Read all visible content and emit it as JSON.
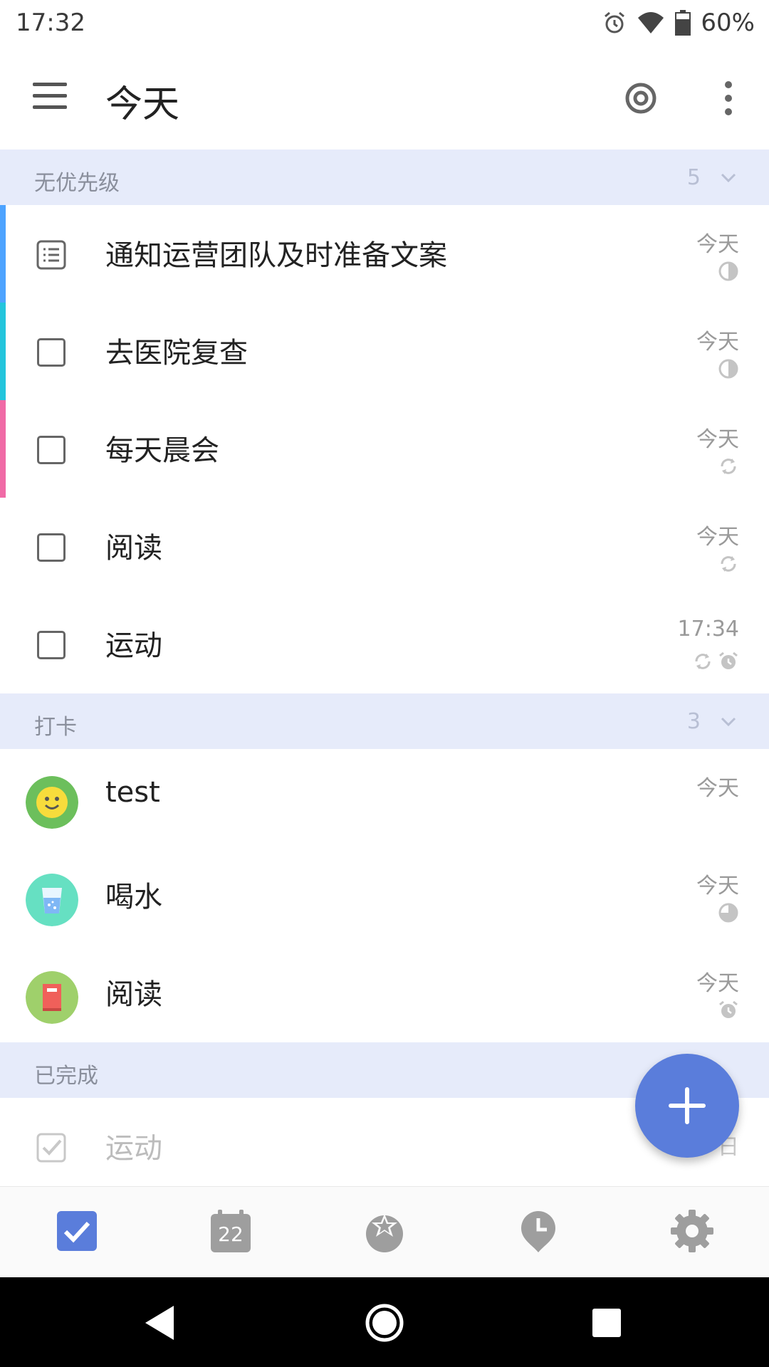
{
  "status_bar": {
    "time": "17:32",
    "battery_percent": "60%"
  },
  "app_bar": {
    "title": "今天"
  },
  "sections": {
    "no_priority": {
      "title": "无优先级",
      "count": "5"
    },
    "checkin": {
      "title": "打卡",
      "count": "3"
    },
    "completed": {
      "title": "已完成"
    }
  },
  "tasks": [
    {
      "title": "通知运营团队及时准备文案",
      "date": "今天",
      "bar_color": "#4da3ff",
      "type": "note",
      "meta": [
        "progress-icon"
      ]
    },
    {
      "title": "去医院复查",
      "date": "今天",
      "bar_color": "#23c5dc",
      "type": "checkbox",
      "meta": [
        "progress-icon"
      ]
    },
    {
      "title": "每天晨会",
      "date": "今天",
      "bar_color": "#f06aa6",
      "type": "checkbox",
      "meta": [
        "repeat-icon"
      ]
    },
    {
      "title": "阅读",
      "date": "今天",
      "type": "checkbox",
      "meta": [
        "repeat-icon"
      ]
    },
    {
      "title": "运动",
      "date": "17:34",
      "type": "checkbox",
      "meta": [
        "repeat-icon",
        "alarm-icon"
      ]
    }
  ],
  "habits": [
    {
      "title": "test",
      "date": "今天",
      "icon": "smiley-icon",
      "color": "#6cbf5c"
    },
    {
      "title": "喝水",
      "date": "今天",
      "icon": "water-glass-icon",
      "color": "#66e0c2",
      "meta": [
        "progress-icon"
      ]
    },
    {
      "title": "阅读",
      "date": "今天",
      "icon": "book-icon",
      "color": "#9fd06b",
      "meta": [
        "alarm-icon"
      ]
    }
  ],
  "completed_tasks": [
    {
      "title": "运动",
      "date_visible": "日"
    }
  ],
  "tab_bar": {
    "calendar_day": "22",
    "active_color": "#5a7ddb",
    "items": [
      "task-tab",
      "calendar-tab",
      "pomodoro-tab",
      "habit-tab",
      "settings-tab"
    ]
  },
  "colors": {
    "accent": "#5a7ddb",
    "section_bg": "#e6ebfa"
  }
}
